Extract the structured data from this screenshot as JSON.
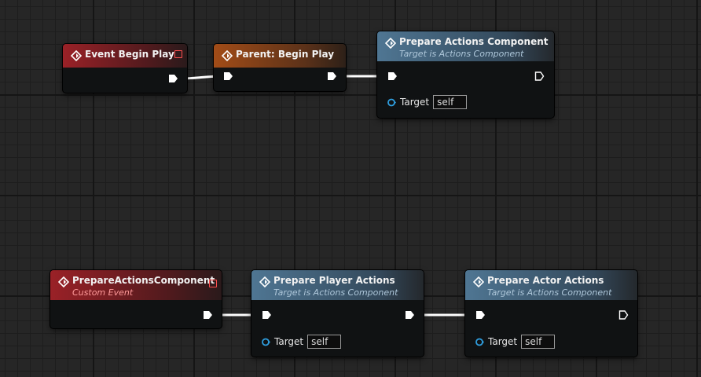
{
  "nodes": {
    "event_begin_play": {
      "title": "Event Begin Play"
    },
    "parent_begin_play": {
      "title": "Parent: Begin Play"
    },
    "prepare_actions_component_call": {
      "title": "Prepare Actions Component",
      "subtitle": "Target is Actions Component",
      "pin_label": "Target",
      "pin_value": "self"
    },
    "custom_event": {
      "title": "PrepareActionsComponent",
      "subtitle": "Custom Event"
    },
    "prepare_player_actions": {
      "title": "Prepare Player Actions",
      "subtitle": "Target is Actions Component",
      "pin_label": "Target",
      "pin_value": "self"
    },
    "prepare_actor_actions": {
      "title": "Prepare Actor Actions",
      "subtitle": "Target is Actions Component",
      "pin_label": "Target",
      "pin_value": "self"
    }
  },
  "colors": {
    "event_header": "#9a2127",
    "parent_header": "#a24c17",
    "function_header": "#4f7693",
    "target_pin": "#2f9fe0",
    "exec_pin": "#ffffff"
  },
  "icons": [
    "event-diamond-icon",
    "function-diamond-icon",
    "exec-pin-icon",
    "object-pin-icon",
    "delegate-square-icon"
  ]
}
